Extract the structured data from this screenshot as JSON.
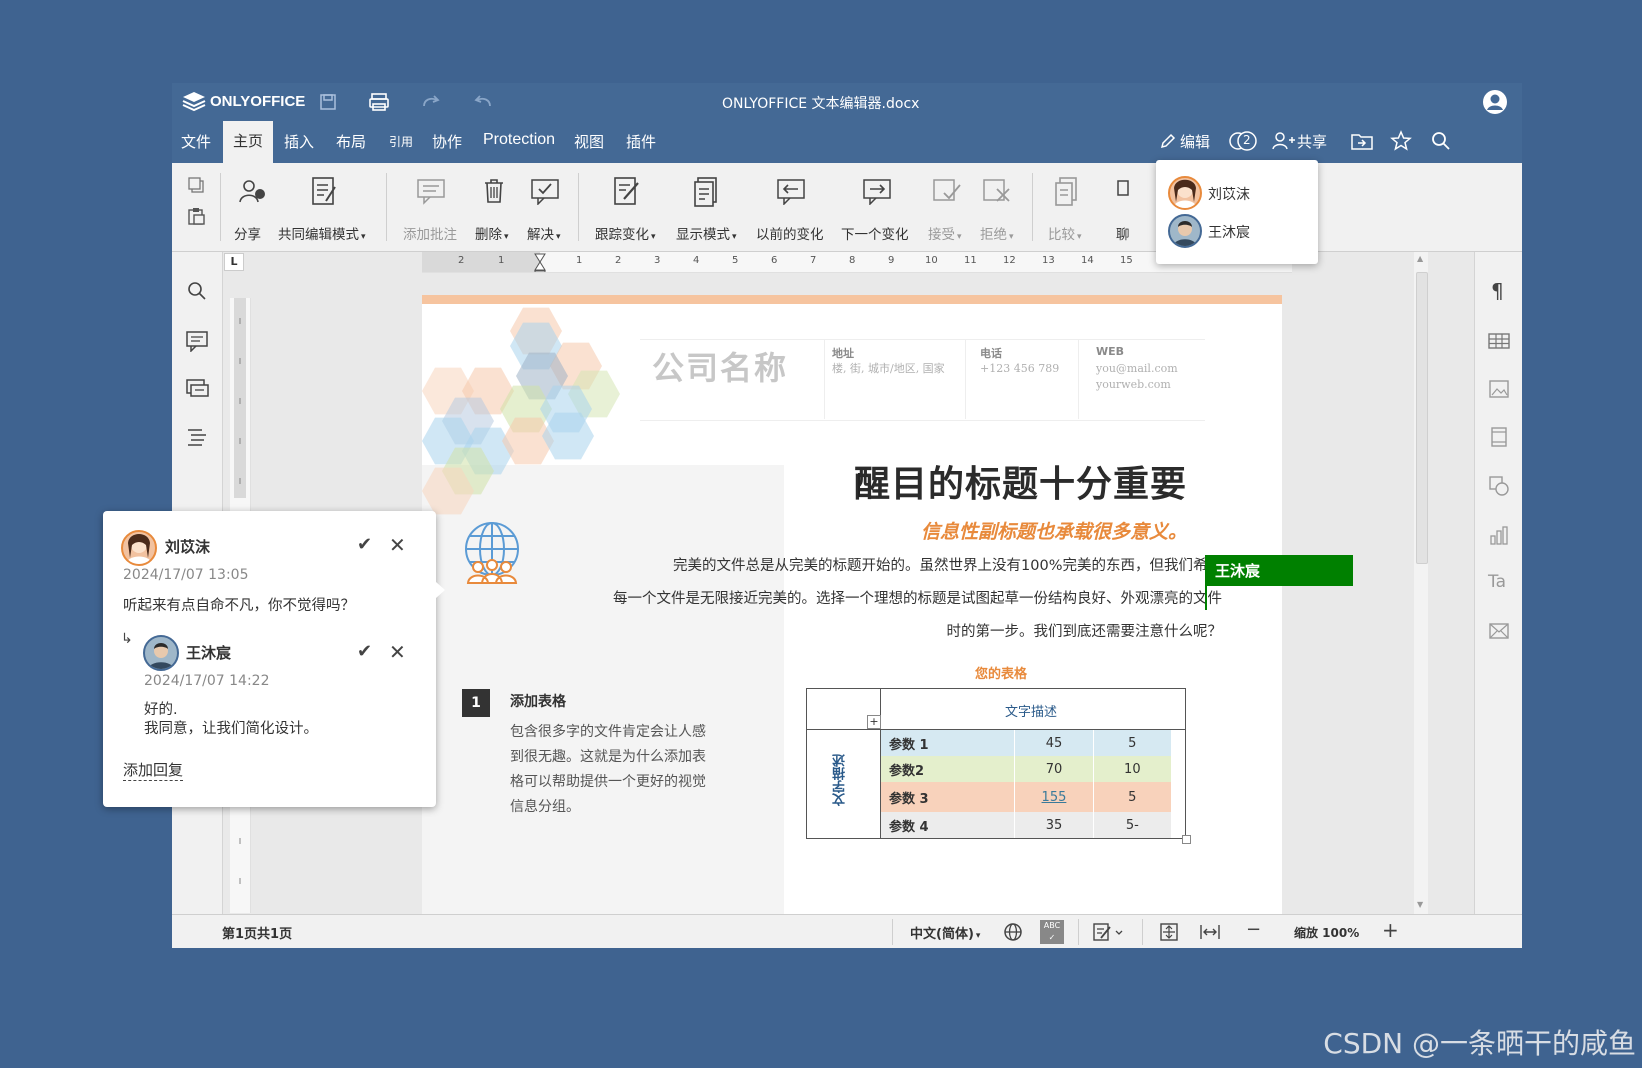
{
  "window": {
    "logo": "ONLYOFFICE",
    "title": "ONLYOFFICE 文本编辑器.docx"
  },
  "menu": {
    "items": [
      "文件",
      "主页",
      "插入",
      "布局",
      "引用",
      "协作",
      "Protection",
      "视图",
      "插件"
    ],
    "active": "主页",
    "right": {
      "edit_label": "编辑",
      "users_count": "2",
      "share_label": "共享"
    }
  },
  "toolbar": {
    "share": "分享",
    "coedit_mode": "共同编辑模式",
    "add_comment": "添加批注",
    "delete": "删除",
    "resolve": "解决",
    "track_changes": "跟踪变化",
    "display_mode": "显示模式",
    "prev_change": "以前的变化",
    "next_change": "下一个变化",
    "accept": "接受",
    "reject": "拒绝",
    "compare": "比较",
    "cut_label": "聊"
  },
  "ruler": {
    "numbers": [
      "2",
      "1",
      "1",
      "2",
      "3",
      "4",
      "5",
      "6",
      "7",
      "8",
      "9",
      "10",
      "11",
      "12",
      "13",
      "14",
      "15"
    ]
  },
  "document": {
    "company_name": "公司名称",
    "address_head": "地址",
    "address_val": "楼, 街, 城市/地区, 国家",
    "phone_head": "电话",
    "phone_val": "+123 456 789",
    "web_head": "WEB",
    "web_val1": "you@mail.com",
    "web_val2": "yourweb.com",
    "headline": "醒目的标题十分重要",
    "subhead": "信息性副标题也承载很多意义。",
    "para_line1": "完美的文件总是从完美的标题开始的。虽然世界上没有100%完美的东西，但我们希望",
    "para_line2": "每一个文件是无限接近完美的。选择一个理想的标题是试图起草一份结构良好、外观漂亮的文件",
    "para_line3": "时的第一步。我们到底还需要注意什么呢？",
    "section_number": "1",
    "section_title": "添加表格",
    "section_line1": "包含很多字的文件肯定会让人感",
    "section_line2": "到很无趣。这就是为什么添加表",
    "section_line3": "格可以帮助提供一个更好的视觉",
    "section_line4": "信息分组。",
    "table_title": "您的表格",
    "table_header": "文字描述",
    "table_side": "文字描述",
    "table_rows": [
      {
        "label": "参数 1",
        "v1": "45",
        "v2": "5"
      },
      {
        "label": "参数2",
        "v1": "70",
        "v2": "10"
      },
      {
        "label": "参数 3",
        "v1": "155",
        "v2": "5"
      },
      {
        "label": "参数 4",
        "v1": "35",
        "v2": "5-"
      }
    ]
  },
  "comments": {
    "author1": "刘苡沫",
    "date1": "2024/17/07 13:05",
    "text1": "听起来有点自命不凡，你不觉得吗？",
    "author2": "王沐宸",
    "date2": "2024/17/07 14:22",
    "text2a": "好的.",
    "text2b": "我同意，让我们简化设计。",
    "add_reply": "添加回复"
  },
  "users_popup": {
    "user1": "刘苡沫",
    "user2": "王沐宸"
  },
  "cursor_tag": "王沐宸",
  "status": {
    "page_info": "第1页共1页",
    "language": "中文(简体)",
    "zoom": "缩放 100%"
  },
  "watermark": "CSDN @一条晒干的咸鱼",
  "colors": {
    "accent": "#446995",
    "background": "#3f6390",
    "orange": "#e88a3c",
    "cursor_green": "#008000"
  }
}
